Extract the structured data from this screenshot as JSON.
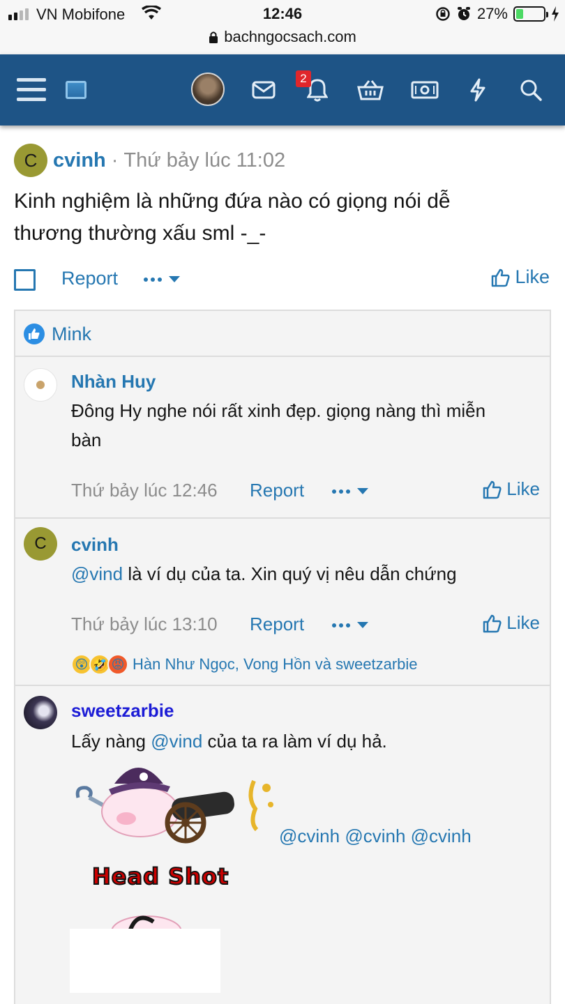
{
  "status_bar": {
    "carrier": "VN Mobifone",
    "time": "12:46",
    "battery_percent": "27%",
    "battery_level": 0.27
  },
  "browser": {
    "url": "bachngocsach.com"
  },
  "nav": {
    "notification_count": "2",
    "icons": [
      "menu-icon",
      "logo-icon",
      "avatar",
      "mail-icon",
      "bell-icon",
      "basket-icon",
      "money-icon",
      "lightning-icon",
      "search-icon"
    ]
  },
  "post": {
    "avatar_letter": "C",
    "username": "cvinh",
    "separator": "·",
    "time": "Thứ bảy lúc 11:02",
    "body_line1": "Kinh nghiệm là những đứa nào có giọng nói dễ",
    "body_line2": "thương thường xấu sml -_-",
    "report_label": "Report",
    "like_label": "Like"
  },
  "reactions_bar": {
    "name": "Mink"
  },
  "comments": [
    {
      "username": "Nhàn Huy",
      "text_line1": "Đông Hy nghe nói rất xinh đẹp. giọng nàng thì miễn",
      "text_line2": "bàn",
      "time": "Thứ bảy lúc 12:46",
      "report_label": "Report",
      "like_label": "Like"
    },
    {
      "avatar_letter": "C",
      "username": "cvinh",
      "mention": "@vind",
      "text": " là ví dụ của ta. Xin quý vị nêu dẫn chứng",
      "time": "Thứ bảy lúc 13:10",
      "report_label": "Report",
      "like_label": "Like",
      "reacted_by": "Hàn Như Ngọc, Vong Hồn và sweetzarbie"
    },
    {
      "username": "sweetzarbie",
      "text_before": "Lấy nàng ",
      "mention": "@vind",
      "text_after": " của ta ra làm ví dụ hả.",
      "mentions_line": "@cvinh @cvinh @cvinh",
      "sticker_caption": "Head Shot"
    }
  ],
  "colors": {
    "nav_bg": "#1e5486",
    "link": "#2577b1",
    "meta": "#8c8c8c",
    "avatar_cvinh": "#999933",
    "sweetzarbie_name": "#1c1cd6"
  }
}
